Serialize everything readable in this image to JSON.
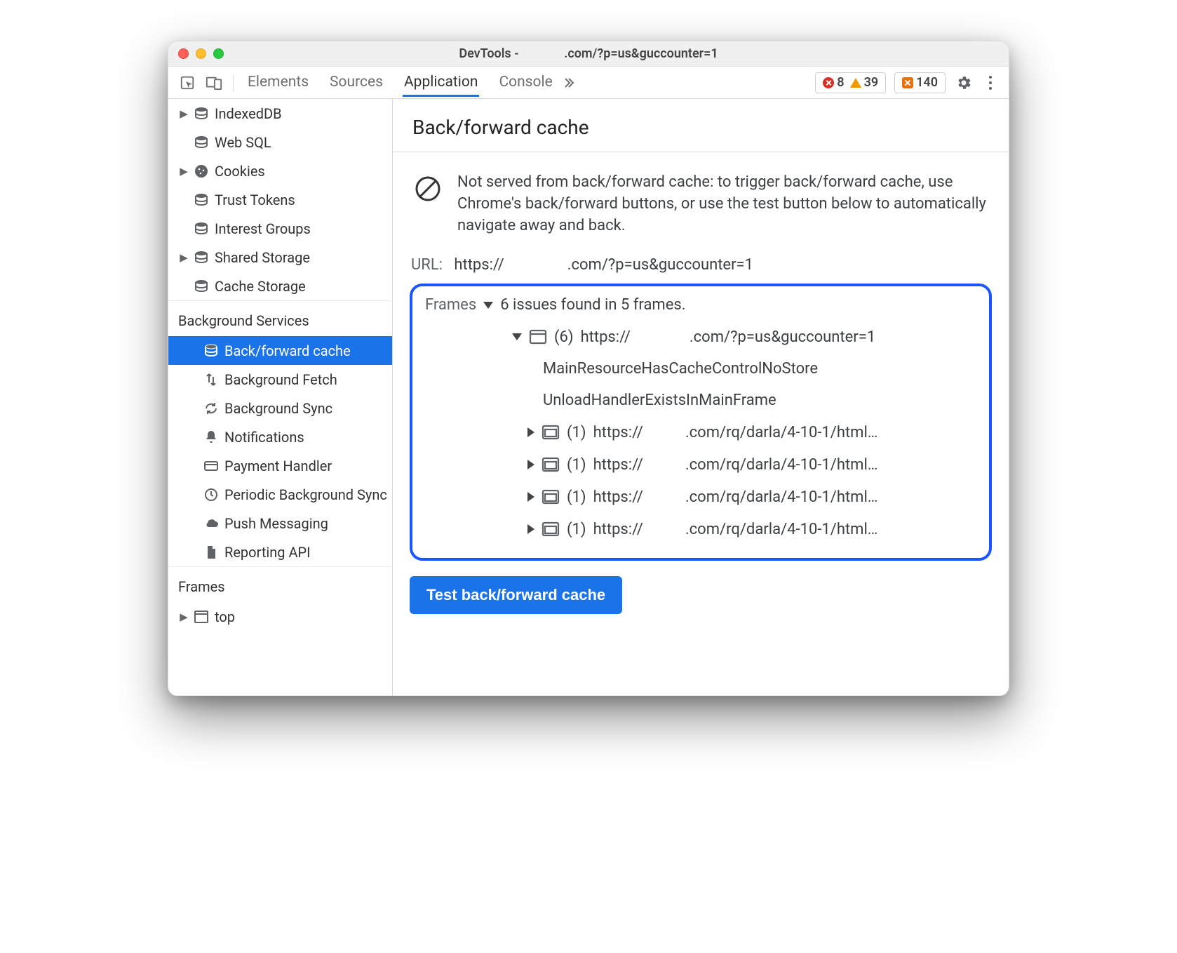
{
  "window": {
    "title_prefix": "DevTools -",
    "title_suffix": ".com/?p=us&guccounter=1"
  },
  "tabs": {
    "items": [
      "Elements",
      "Sources",
      "Application",
      "Console"
    ],
    "active": "Application"
  },
  "badges": {
    "errors": "8",
    "warnings": "39",
    "issues": "140"
  },
  "sidebar": {
    "storage_items": [
      {
        "label": "IndexedDB",
        "icon": "database",
        "expand": true
      },
      {
        "label": "Web SQL",
        "icon": "database",
        "expand": false
      },
      {
        "label": "Cookies",
        "icon": "cookie",
        "expand": true
      },
      {
        "label": "Trust Tokens",
        "icon": "database",
        "expand": false
      },
      {
        "label": "Interest Groups",
        "icon": "database",
        "expand": false
      },
      {
        "label": "Shared Storage",
        "icon": "database",
        "expand": true
      },
      {
        "label": "Cache Storage",
        "icon": "database",
        "expand": false
      }
    ],
    "bg_label": "Background Services",
    "bg_items": [
      {
        "label": "Back/forward cache",
        "icon": "database",
        "selected": true
      },
      {
        "label": "Background Fetch",
        "icon": "transfer"
      },
      {
        "label": "Background Sync",
        "icon": "sync"
      },
      {
        "label": "Notifications",
        "icon": "bell"
      },
      {
        "label": "Payment Handler",
        "icon": "card"
      },
      {
        "label": "Periodic Background Sync",
        "icon": "clock"
      },
      {
        "label": "Push Messaging",
        "icon": "cloud"
      },
      {
        "label": "Reporting API",
        "icon": "file"
      }
    ],
    "frames_label": "Frames",
    "frames_items": [
      {
        "label": "top",
        "icon": "frame",
        "expand": true
      }
    ]
  },
  "main": {
    "title": "Back/forward cache",
    "banner": "Not served from back/forward cache: to trigger back/forward cache, use Chrome's back/forward buttons, or use the test button below to automatically navigate away and back.",
    "url_label": "URL:",
    "url_prefix": "https://",
    "url_suffix": ".com/?p=us&guccounter=1",
    "frames_label": "Frames",
    "frames_summary": "6 issues found in 5 frames.",
    "top_frame_count": "(6)",
    "top_frame_prefix": "https://",
    "top_frame_suffix": ".com/?p=us&guccounter=1",
    "reasons": [
      "MainResourceHasCacheControlNoStore",
      "UnloadHandlerExistsInMainFrame"
    ],
    "subframes": [
      {
        "count": "(1)",
        "prefix": "https://",
        "suffix": ".com/rq/darla/4-10-1/html…"
      },
      {
        "count": "(1)",
        "prefix": "https://",
        "suffix": ".com/rq/darla/4-10-1/html…"
      },
      {
        "count": "(1)",
        "prefix": "https://",
        "suffix": ".com/rq/darla/4-10-1/html…"
      },
      {
        "count": "(1)",
        "prefix": "https://",
        "suffix": ".com/rq/darla/4-10-1/html…"
      }
    ],
    "test_button": "Test back/forward cache"
  }
}
